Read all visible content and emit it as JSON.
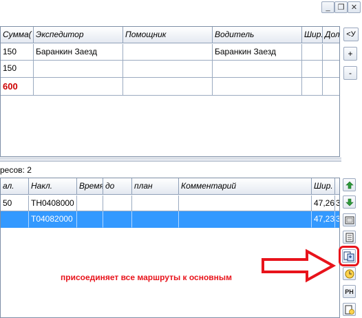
{
  "window_controls": {
    "minimize": "_",
    "restore": "❐",
    "close": "✕"
  },
  "top_grid": {
    "columns": [
      "Сумма(",
      "Экспедитор",
      "Помощник",
      "Водитель",
      "Шир.",
      "Дол"
    ],
    "rows": [
      {
        "sum": "150",
        "expeditor": "Баранкин Заезд",
        "helper": "",
        "driver": "Баранкин Заезд",
        "lat": "",
        "lon": ""
      },
      {
        "sum": "150",
        "expeditor": "",
        "helper": "",
        "driver": "",
        "lat": "",
        "lon": ""
      },
      {
        "sum": "600",
        "expeditor": "",
        "helper": "",
        "driver": "",
        "lat": "",
        "lon": ""
      }
    ],
    "total_color": "#cc0000"
  },
  "top_side_buttons": {
    "collapse": "<У",
    "add": "+",
    "remove": "-"
  },
  "addresses_label": "ресов: 2",
  "bottom_grid": {
    "columns": [
      "ал.",
      "Накл.",
      "Время",
      "до",
      "план",
      "Комментарий",
      "Шир.",
      ""
    ],
    "rows": [
      {
        "nal": "50",
        "nakl": "ТН0408000",
        "time": "",
        "to": "",
        "plan": "",
        "comment": "",
        "lat": "47,26",
        "extra": "3"
      },
      {
        "nal": "",
        "nakl": "Т04082000",
        "time": "",
        "to": "",
        "plan": "",
        "comment": "",
        "lat": "47,23",
        "extra": "3"
      }
    ],
    "selection_color": "#3399ff"
  },
  "toolbar": {
    "up_icon": "arrow-up-icon",
    "down_icon": "arrow-down-icon",
    "label_icon_text": "a",
    "ph_label": "PH"
  },
  "annotation": {
    "text": "присоединяет все маршруты к основным",
    "color": "#e8131b"
  }
}
